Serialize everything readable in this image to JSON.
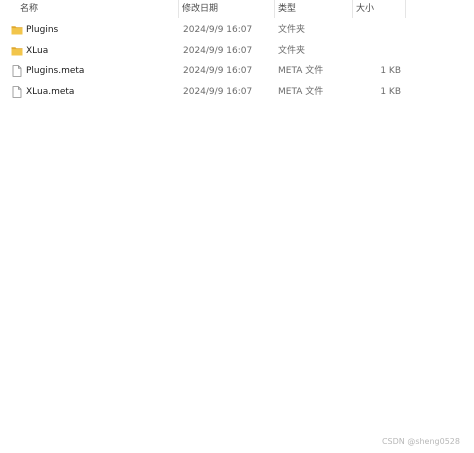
{
  "columns": {
    "name": "名称",
    "date": "修改日期",
    "type": "类型",
    "size": "大小"
  },
  "sort_indicator": "^",
  "files": [
    {
      "name": "Plugins",
      "date": "2024/9/9 16:07",
      "type": "文件夹",
      "size": "",
      "icon": "folder-icon"
    },
    {
      "name": "XLua",
      "date": "2024/9/9 16:07",
      "type": "文件夹",
      "size": "",
      "icon": "folder-icon"
    },
    {
      "name": "Plugins.meta",
      "date": "2024/9/9 16:07",
      "type": "META 文件",
      "size": "1 KB",
      "icon": "file-icon"
    },
    {
      "name": "XLua.meta",
      "date": "2024/9/9 16:07",
      "type": "META 文件",
      "size": "1 KB",
      "icon": "file-icon"
    }
  ],
  "watermark": "CSDN @sheng0528",
  "colors": {
    "folder": "#f2c54b",
    "folder_dark": "#e0a82e",
    "header_text": "#4a4a4a"
  }
}
